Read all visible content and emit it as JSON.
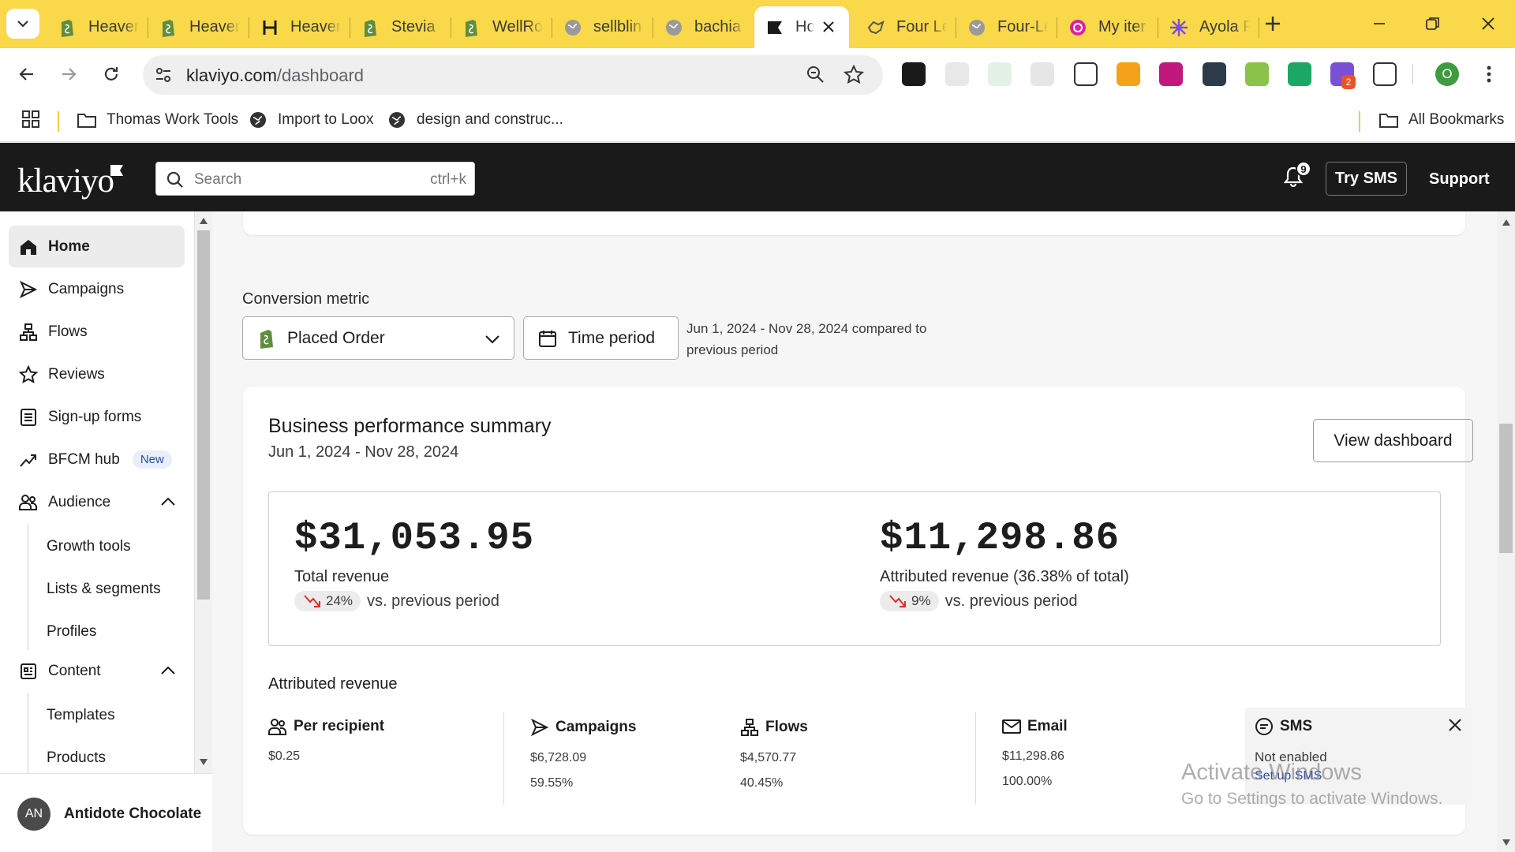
{
  "browser": {
    "tabs": [
      {
        "label": "Heaven",
        "icon": "shopify-icon"
      },
      {
        "label": "Heaven",
        "icon": "shopify-icon"
      },
      {
        "label": "Heaven",
        "icon": "h-logo-icon"
      },
      {
        "label": "Stevia",
        "icon": "shopify-icon"
      },
      {
        "label": "WellRo",
        "icon": "shopify-icon"
      },
      {
        "label": "sellblin",
        "icon": "globe-icon"
      },
      {
        "label": "bachia",
        "icon": "globe-icon"
      },
      {
        "label": "Ho",
        "icon": "klaviyo-flag-icon",
        "active": true
      },
      {
        "label": "Four Le",
        "icon": "link-icon"
      },
      {
        "label": "Four-Le",
        "icon": "globe-icon"
      },
      {
        "label": "My iter",
        "icon": "camera-icon"
      },
      {
        "label": "Ayola F",
        "icon": "sparkle-icon"
      }
    ],
    "url_domain": "klaviyo.com",
    "url_path": "/dashboard",
    "profile_initial": "O",
    "ext_badge": "2",
    "bookmarks": [
      {
        "label": "Thomas Work Tools",
        "icon": "folder-icon"
      },
      {
        "label": "Import to Loox",
        "icon": "globe-icon"
      },
      {
        "label": "design and construc...",
        "icon": "globe-icon"
      }
    ],
    "all_bookmarks": "All Bookmarks"
  },
  "header": {
    "logo": "klaviyo",
    "search_placeholder": "Search",
    "search_shortcut": "ctrl+k",
    "notifications_count": "9",
    "try_sms": "Try SMS",
    "support": "Support"
  },
  "sidebar": {
    "items": [
      {
        "label": "Home",
        "icon": "home-icon",
        "active": true
      },
      {
        "label": "Campaigns",
        "icon": "send-icon"
      },
      {
        "label": "Flows",
        "icon": "flows-icon"
      },
      {
        "label": "Reviews",
        "icon": "star-icon"
      },
      {
        "label": "Sign-up forms",
        "icon": "form-icon"
      },
      {
        "label": "BFCM hub",
        "icon": "trend-icon",
        "badge": "New"
      },
      {
        "label": "Audience",
        "icon": "people-icon"
      },
      {
        "label": "Content",
        "icon": "content-icon"
      }
    ],
    "audience_sub": [
      "Growth tools",
      "Lists & segments",
      "Profiles"
    ],
    "content_sub": [
      "Templates",
      "Products"
    ],
    "account_initials": "AN",
    "account_name": "Antidote Chocolate"
  },
  "main": {
    "conversion_label": "Conversion metric",
    "conversion_value": "Placed Order",
    "time_period": "Time period",
    "date_range": "Jun 1, 2024 - Nov 28, 2024 compared to previous period",
    "summary": {
      "title": "Business performance summary",
      "range": "Jun 1, 2024 - Nov 28, 2024",
      "view_dashboard": "View dashboard",
      "total_revenue": "$31,053.95",
      "total_revenue_label": "Total revenue",
      "total_change": "24%",
      "attributed_revenue": "$11,298.86",
      "attributed_revenue_label": "Attributed revenue (36.38% of total)",
      "attributed_change": "9%",
      "vs_text": "vs. previous period",
      "trend_color": "#d93025"
    },
    "attributed": {
      "title": "Attributed revenue",
      "columns": [
        {
          "label": "Per recipient",
          "v1": "$0.25",
          "v2": ""
        },
        {
          "label": "Campaigns",
          "v1": "$6,728.09",
          "v2": "59.55%"
        },
        {
          "label": "Flows",
          "v1": "$4,570.77",
          "v2": "40.45%"
        },
        {
          "label": "Email",
          "v1": "$11,298.86",
          "v2": "100.00%"
        }
      ],
      "sms_label": "SMS",
      "sms_status": "Not enabled",
      "sms_setup": "Set up SMS"
    }
  },
  "os": {
    "watermark_line1": "Activate Windows",
    "watermark_line2": "Go to Settings to activate Windows."
  }
}
